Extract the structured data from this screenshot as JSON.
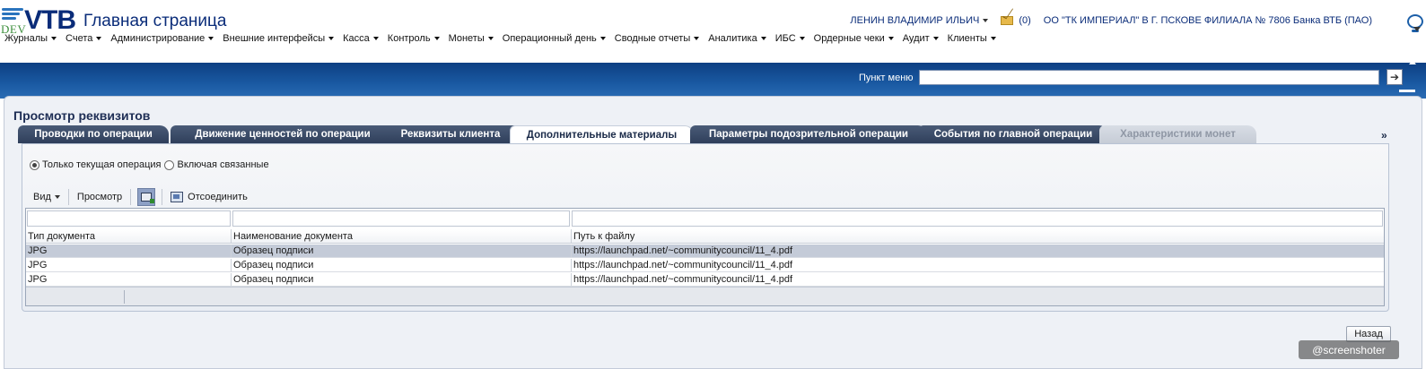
{
  "header": {
    "logo_dev": "DEV",
    "logo_vtb": "VTB",
    "title": "Главная страница",
    "user_name": "ЛЕНИН ВЛАДИМИР ИЛЬИЧ",
    "mail_count": "(0)",
    "org_name": "ОО \"ТК ИМПЕРИАЛ\" В Г. ПСКОВЕ ФИЛИАЛА № 7806 Банка ВТБ (ПАО)"
  },
  "menu": [
    {
      "label": "Журналы"
    },
    {
      "label": "Счета"
    },
    {
      "label": "Администрирование"
    },
    {
      "label": "Внешние интерфейсы"
    },
    {
      "label": "Касса"
    },
    {
      "label": "Контроль"
    },
    {
      "label": "Монеты"
    },
    {
      "label": "Операционный день"
    },
    {
      "label": "Сводные отчеты"
    },
    {
      "label": "Аналитика"
    },
    {
      "label": "ИБС"
    },
    {
      "label": "Ордерные чеки"
    },
    {
      "label": "Аудит"
    },
    {
      "label": "Клиенты"
    }
  ],
  "menu_search": {
    "label": "Пункт меню",
    "value": ""
  },
  "panel": {
    "title": "Просмотр реквизитов"
  },
  "tabs": [
    {
      "label": "Проводки по операции",
      "state": "normal"
    },
    {
      "label": "Движение ценностей по операции",
      "state": "normal"
    },
    {
      "label": "Реквизиты клиента",
      "state": "normal"
    },
    {
      "label": "Дополнительные материалы",
      "state": "active"
    },
    {
      "label": "Параметры подозрительной операции",
      "state": "normal"
    },
    {
      "label": "События по главной операции",
      "state": "normal"
    },
    {
      "label": "Характеристики монет",
      "state": "disabled"
    }
  ],
  "tabs_more": "»",
  "radios": {
    "current_only": "Только текущая операция",
    "including_related": "Включая связанные",
    "selected": "current_only"
  },
  "toolbar": {
    "view": "Вид",
    "preview": "Просмотр",
    "detach": "Отсоединить"
  },
  "table": {
    "columns": [
      "Тип документа",
      "Наименование документа",
      "Путь к файлу"
    ],
    "rows": [
      {
        "type": "JPG",
        "name": "Образец подписи",
        "path": "https://launchpad.net/~communitycouncil/11_4.pdf",
        "selected": true
      },
      {
        "type": "JPG",
        "name": "Образец подписи",
        "path": "https://launchpad.net/~communitycouncil/11_4.pdf",
        "selected": false
      },
      {
        "type": "JPG",
        "name": "Образец подписи",
        "path": "https://launchpad.net/~communitycouncil/11_4.pdf",
        "selected": false
      }
    ]
  },
  "back_button": "Назад",
  "watermark": "@screenshoter",
  "colors": {
    "brand_blue": "#0a2c79",
    "band_blue": "#1a5aa3",
    "tab_dark": "#2f3f5b",
    "selected_row": "#c4cbd8"
  }
}
